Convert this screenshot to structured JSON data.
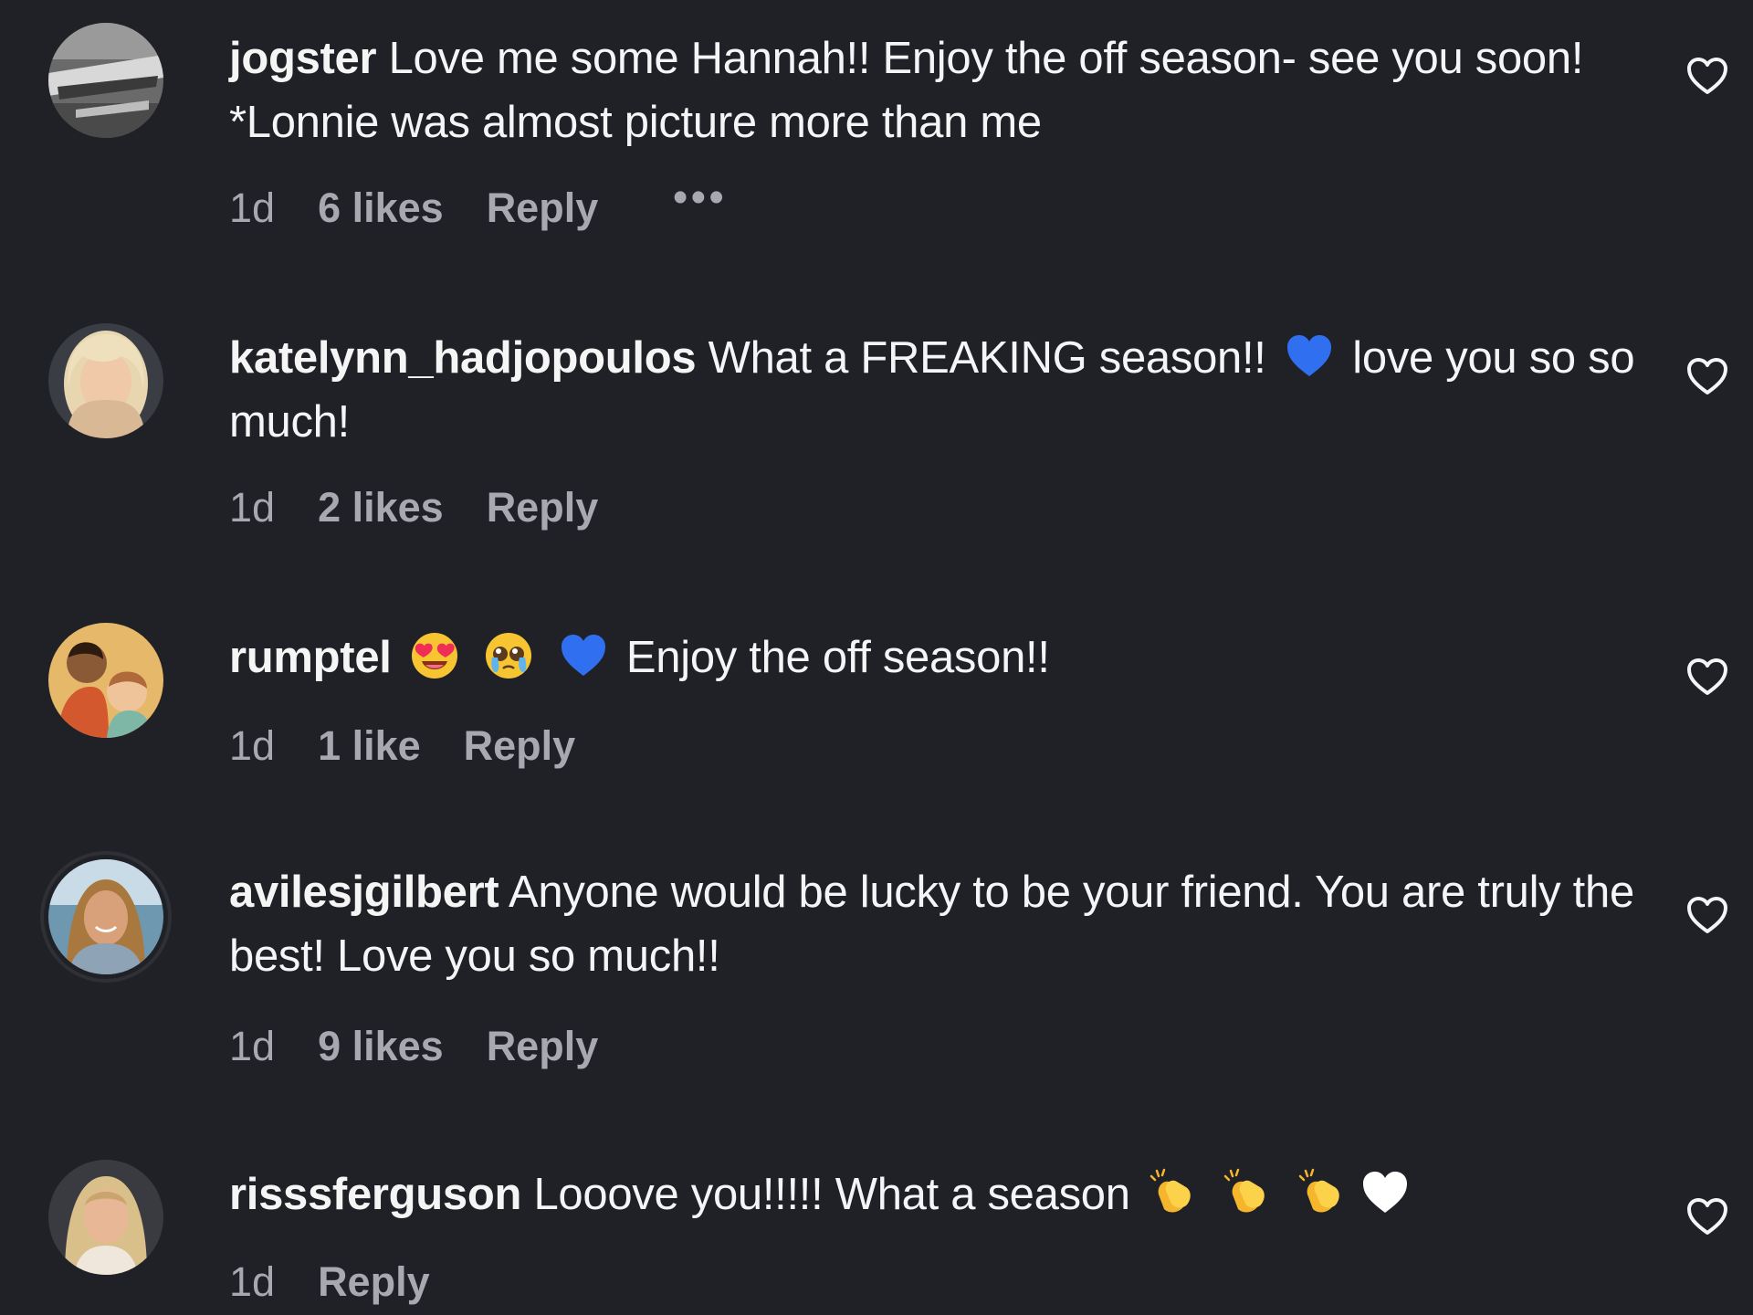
{
  "comments": [
    {
      "username": "jogster",
      "text": "Love me some Hannah!! Enjoy the off season- see you soon! *Lonnie was almost picture more than me",
      "time": "1d",
      "likes": "6 likes",
      "reply": "Reply",
      "more": "•••"
    },
    {
      "username": "katelynn_hadjopoulos",
      "text_before": "What a FREAKING season!!",
      "text_after": "love you so so much!",
      "time": "1d",
      "likes": "2 likes",
      "reply": "Reply"
    },
    {
      "username": "rumptel",
      "text": "Enjoy the off season!!",
      "time": "1d",
      "likes": "1 like",
      "reply": "Reply"
    },
    {
      "username": "avilesjgilbert",
      "text": "Anyone would be lucky to be your friend. You are truly the best! Love you so much!!",
      "time": "1d",
      "likes": "9 likes",
      "reply": "Reply"
    },
    {
      "username": "risssferguson",
      "text": "Looove you!!!!! What a season",
      "time": "1d",
      "reply": "Reply"
    }
  ],
  "emoji_names": [
    "blue-heart",
    "heart-eyes-face",
    "pleading-face",
    "clapping-hands",
    "white-heart"
  ],
  "colors": {
    "background": "#202126",
    "text": "#f3f5f7",
    "meta": "#a8a8b0",
    "blue_heart": "#2f6ff0"
  }
}
